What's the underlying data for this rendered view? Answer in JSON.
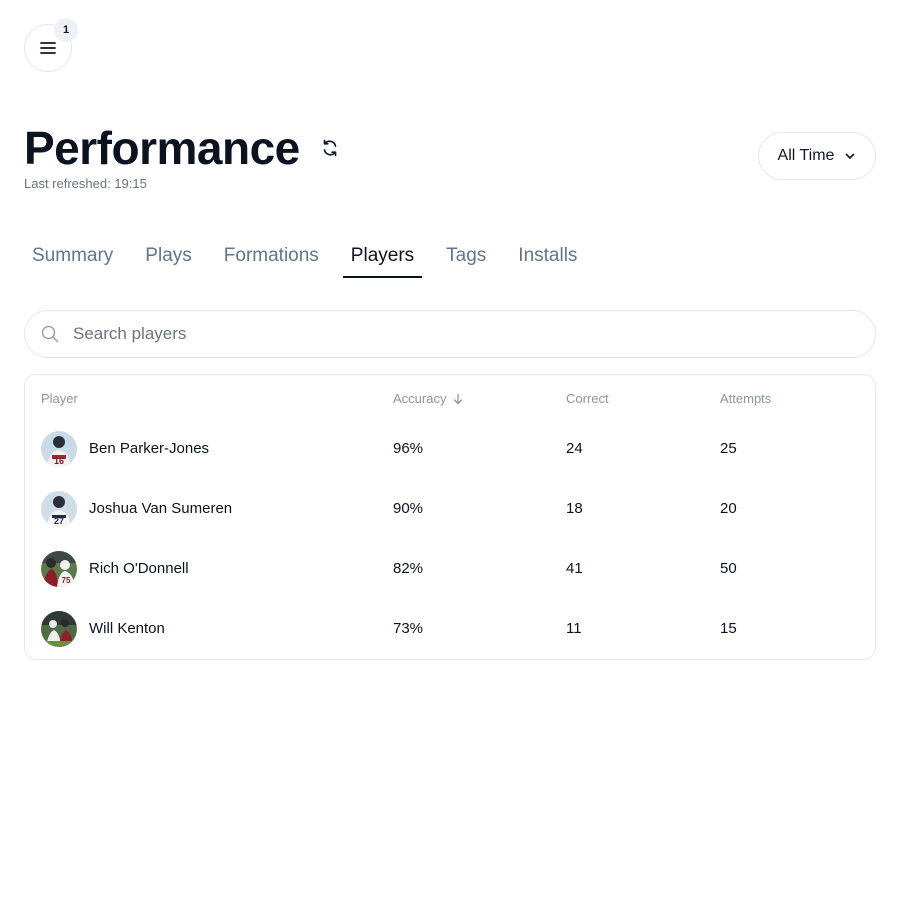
{
  "menu": {
    "badge_count": "1"
  },
  "header": {
    "title": "Performance",
    "last_refreshed": "Last refreshed: 19:15",
    "range_label": "All Time"
  },
  "tabs": [
    {
      "label": "Summary",
      "active": false
    },
    {
      "label": "Plays",
      "active": false
    },
    {
      "label": "Formations",
      "active": false
    },
    {
      "label": "Players",
      "active": true
    },
    {
      "label": "Tags",
      "active": false
    },
    {
      "label": "Installs",
      "active": false
    }
  ],
  "search": {
    "placeholder": "Search players"
  },
  "table": {
    "columns": {
      "player": "Player",
      "accuracy": "Accuracy",
      "correct": "Correct",
      "attempts": "Attempts"
    },
    "sort": {
      "column": "accuracy",
      "direction": "descending"
    },
    "rows": [
      {
        "name": "Ben Parker-Jones",
        "accuracy": "96%",
        "correct": "24",
        "attempts": "25",
        "jersey": "16",
        "bg": "#c9dbe8"
      },
      {
        "name": "Joshua Van Sumeren",
        "accuracy": "90%",
        "correct": "18",
        "attempts": "20",
        "jersey": "27",
        "bg": "#cfdde8"
      },
      {
        "name": "Rich O'Donnell",
        "accuracy": "82%",
        "correct": "41",
        "attempts": "50",
        "jersey": "75",
        "bg": "#5d7a4e"
      },
      {
        "name": "Will Kenton",
        "accuracy": "73%",
        "correct": "11",
        "attempts": "15",
        "jersey": "",
        "bg": "#4f6b44"
      }
    ]
  },
  "colors": {
    "accent": "#0b1220",
    "muted": "#64748b",
    "border": "#e5e7eb"
  }
}
